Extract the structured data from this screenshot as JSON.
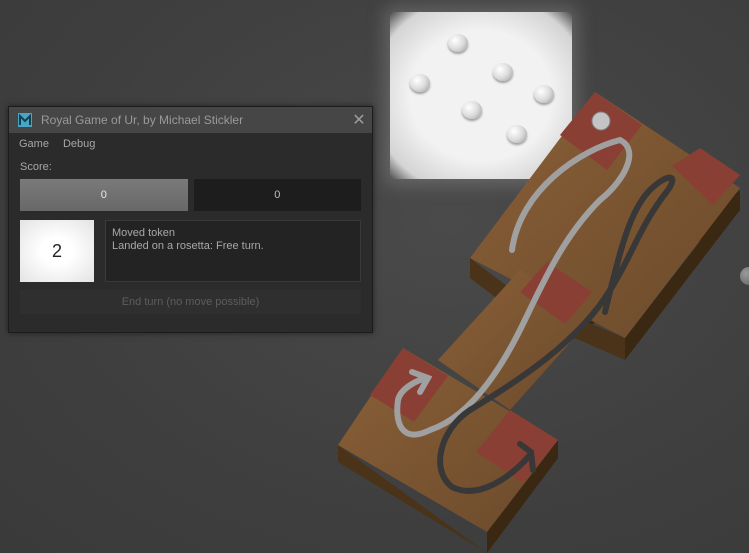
{
  "window": {
    "title": "Royal Game of Ur, by Michael Stickler",
    "icon": "maya-m-icon",
    "close_symbol": "✕"
  },
  "menu": [
    "Game",
    "Debug"
  ],
  "score": {
    "label": "Score:",
    "player1": "0",
    "player2": "0"
  },
  "dice": {
    "value": "2"
  },
  "messages": {
    "line1": "Moved token",
    "line2": "Landed on a rosetta: Free turn."
  },
  "end_turn": {
    "label": "End turn (no move possible)",
    "enabled": false
  },
  "colors": {
    "board_top": "#7a5534",
    "board_side": "#4f3618",
    "rosetta": "#8a3f34",
    "path_light": "#9a9a9a",
    "path_dark": "#3a3a3a",
    "background": "#434343"
  }
}
